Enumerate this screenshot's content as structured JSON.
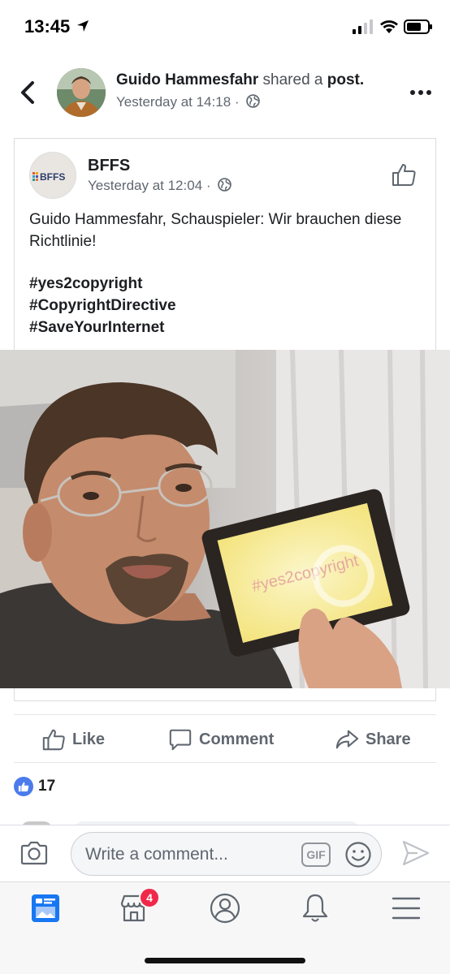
{
  "status_bar": {
    "time": "13:45",
    "icons": [
      "location-arrow-icon",
      "signal-icon",
      "wifi-icon",
      "battery-icon"
    ]
  },
  "post_header": {
    "sharer_name": "Guido Hammesfahr",
    "action_text": "shared a",
    "object_text": "post.",
    "timestamp": "Yesterday at 14:18 ·",
    "privacy_icon": "globe-icon"
  },
  "shared_post": {
    "page_name": "BFFS",
    "logo_text": "BFFS",
    "timestamp": "Yesterday at 12:04 ·",
    "text_line1": "Guido Hammesfahr, Schauspieler: Wir brauchen diese Richtlinie!",
    "hashtags": [
      "#yes2copyright",
      "#CopyrightDirective",
      "#SaveYourInternet"
    ],
    "photo_tablet_text": "#yes2copyright"
  },
  "actions": {
    "like": "Like",
    "comment": "Comment",
    "share": "Share"
  },
  "reactions": {
    "count": "17"
  },
  "composer": {
    "placeholder": "Write a comment...",
    "gif_label": "GIF"
  },
  "tabbar": {
    "items": [
      "news-feed",
      "marketplace",
      "profile",
      "notifications",
      "menu"
    ],
    "marketplace_badge": "4"
  },
  "colors": {
    "accent": "#1877f2",
    "like_badge": "#4b7bec",
    "notification_badge": "#f02849",
    "muted_text": "#606770"
  }
}
